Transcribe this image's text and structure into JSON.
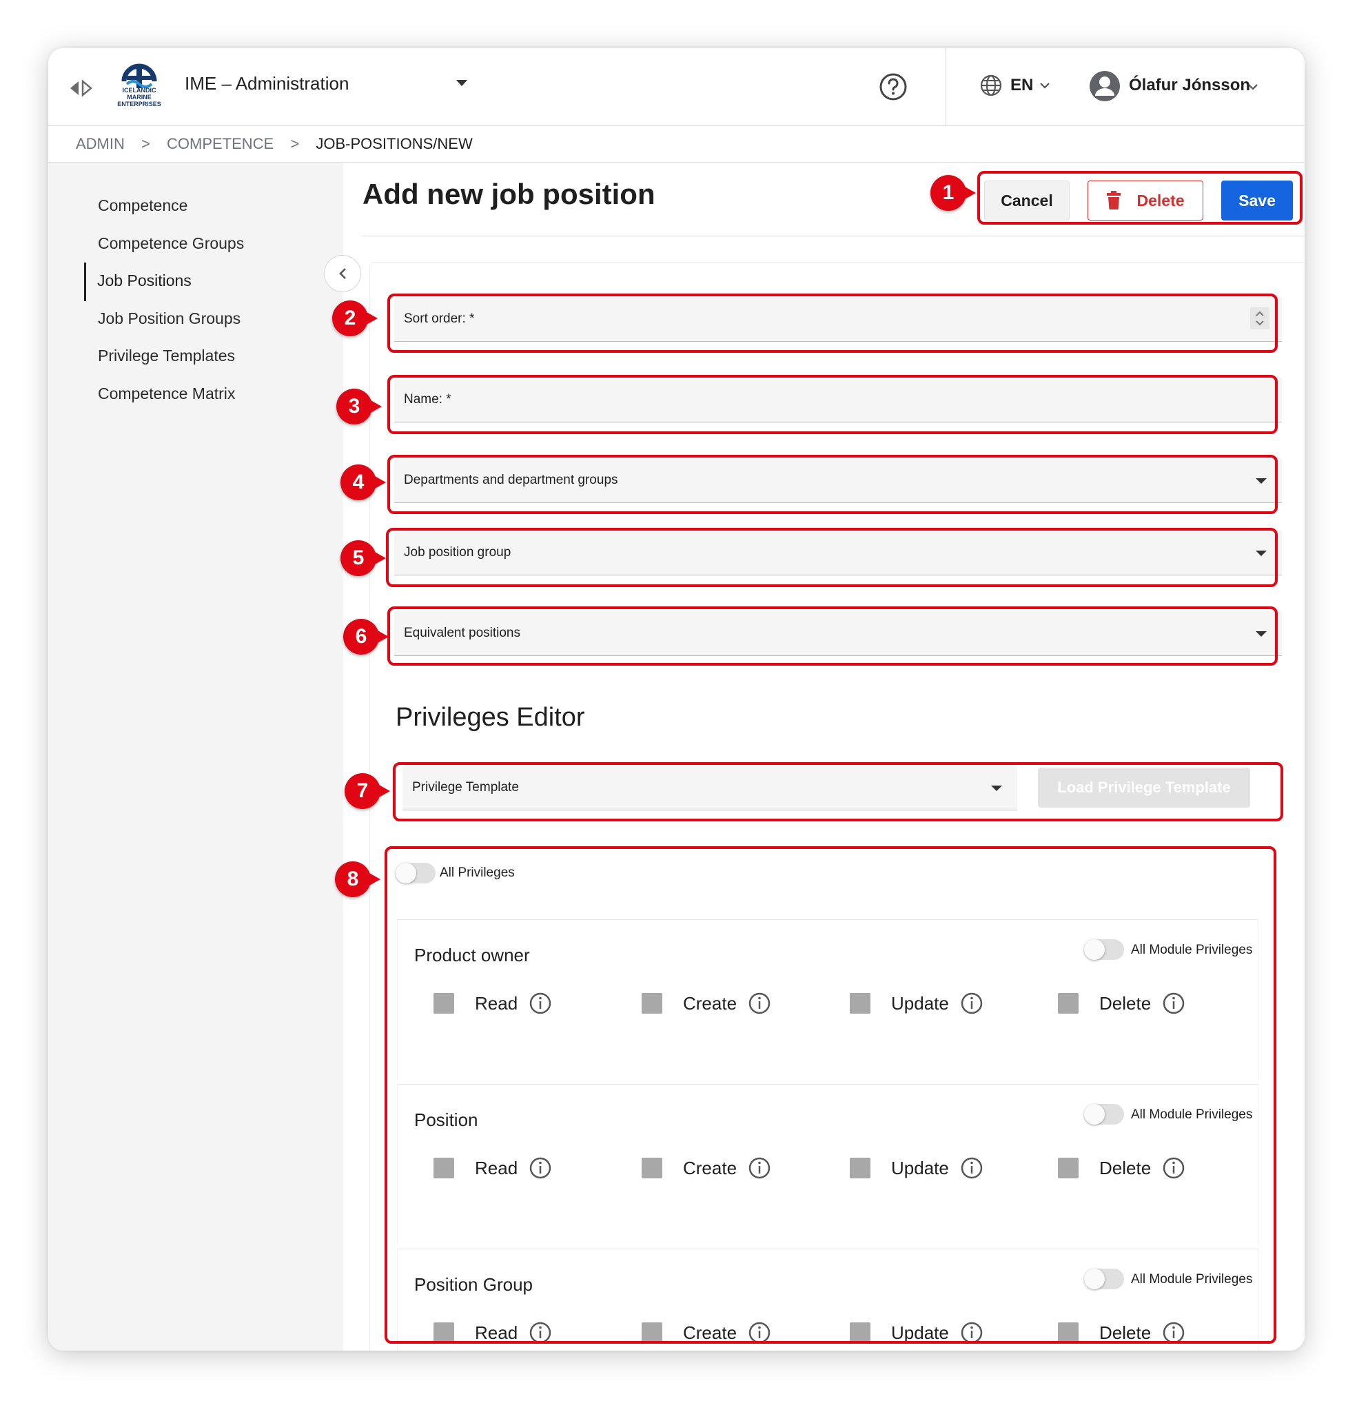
{
  "header": {
    "logo_text": "ICELANDIC MARINE ENTERPRISES",
    "app_title": "IME – Administration",
    "language": "EN",
    "user_name": "Ólafur Jónsson"
  },
  "breadcrumb": [
    "ADMIN",
    ">",
    "COMPETENCE",
    ">",
    "JOB-POSITIONS/NEW"
  ],
  "sidebar": {
    "items": [
      {
        "label": "Competence"
      },
      {
        "label": "Competence Groups"
      },
      {
        "label": "Job Positions",
        "active": true
      },
      {
        "label": "Job Position Groups"
      },
      {
        "label": "Privilege Templates"
      },
      {
        "label": "Competence Matrix"
      }
    ]
  },
  "page": {
    "title": "Add new job position",
    "cancel_label": "Cancel",
    "delete_label": "Delete",
    "save_label": "Save"
  },
  "form": {
    "sort_order_label": "Sort order: *",
    "name_label": "Name: *",
    "departments_label": "Departments and department groups",
    "job_position_group_label": "Job position group",
    "equivalent_positions_label": "Equivalent positions"
  },
  "privileges": {
    "section_title": "Privileges Editor",
    "template_label": "Privilege Template",
    "load_template_label": "Load Privilege Template",
    "all_privileges_label": "All Privileges",
    "all_privileges_on": false,
    "all_module_label": "All Module Privileges",
    "actions": [
      "Read",
      "Create",
      "Update",
      "Delete"
    ],
    "modules": [
      {
        "name": "Product owner"
      },
      {
        "name": "Position"
      },
      {
        "name": "Position Group"
      }
    ]
  },
  "annotations": [
    "1",
    "2",
    "3",
    "4",
    "5",
    "6",
    "7",
    "8"
  ],
  "colors": {
    "primary": "#1565e0",
    "danger": "#d32f2f",
    "annotation": "#e10613",
    "sidebar_bg": "#f4f4f4"
  }
}
